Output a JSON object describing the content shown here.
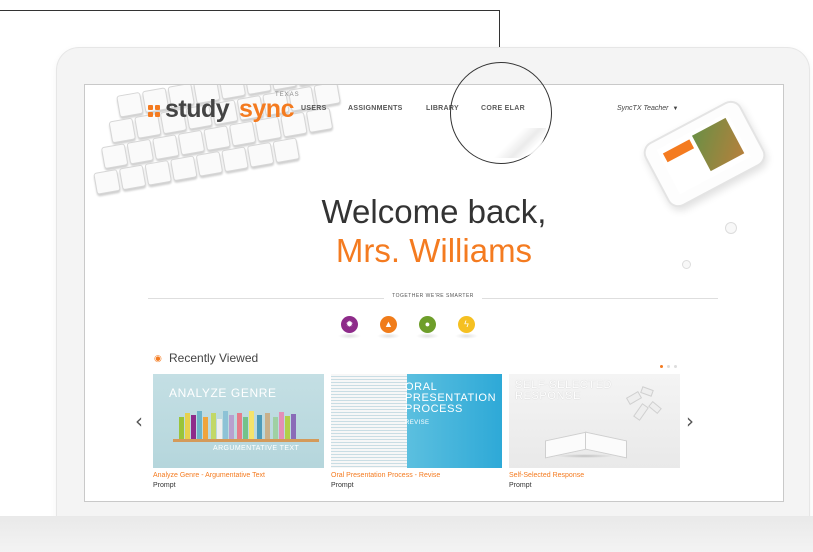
{
  "header": {
    "logo": {
      "study": "study",
      "sync": "sync",
      "region": "TEXAS"
    },
    "nav": [
      "USERS",
      "ASSIGNMENTS",
      "LIBRARY",
      "CORE ELAR"
    ],
    "user_menu": "SyncTX Teacher"
  },
  "hero": {
    "greeting": "Welcome back,",
    "name": "Mrs. Williams",
    "tagline": "TOGETHER WE'RE SMARTER"
  },
  "feature_icons": [
    {
      "icon": "starburst-icon",
      "color": "#8e2b8a"
    },
    {
      "icon": "bell-icon",
      "color": "#f07c1a"
    },
    {
      "icon": "lightbulb-icon",
      "color": "#6e9e2a"
    },
    {
      "icon": "lightning-icon",
      "color": "#f5c021"
    }
  ],
  "recently_viewed": {
    "title": "Recently Viewed",
    "cards": [
      {
        "image_title": "ANALYZE GENRE",
        "image_subtitle": "ARGUMENTATIVE TEXT",
        "name": "Analyze Genre - Argumentative Text",
        "type": "Prompt"
      },
      {
        "image_title": "ORAL PRESENTATION PROCESS",
        "image_subtitle": "REVISE",
        "name": "Oral Presentation Process - Revise",
        "type": "Prompt"
      },
      {
        "image_title": "SELF-SELECTED RESPONSE",
        "name": "Self-Selected Response",
        "type": "Prompt"
      }
    ],
    "page_count": 3,
    "active_page": 1
  },
  "colors": {
    "accent": "#f47b20",
    "text": "#333333"
  }
}
